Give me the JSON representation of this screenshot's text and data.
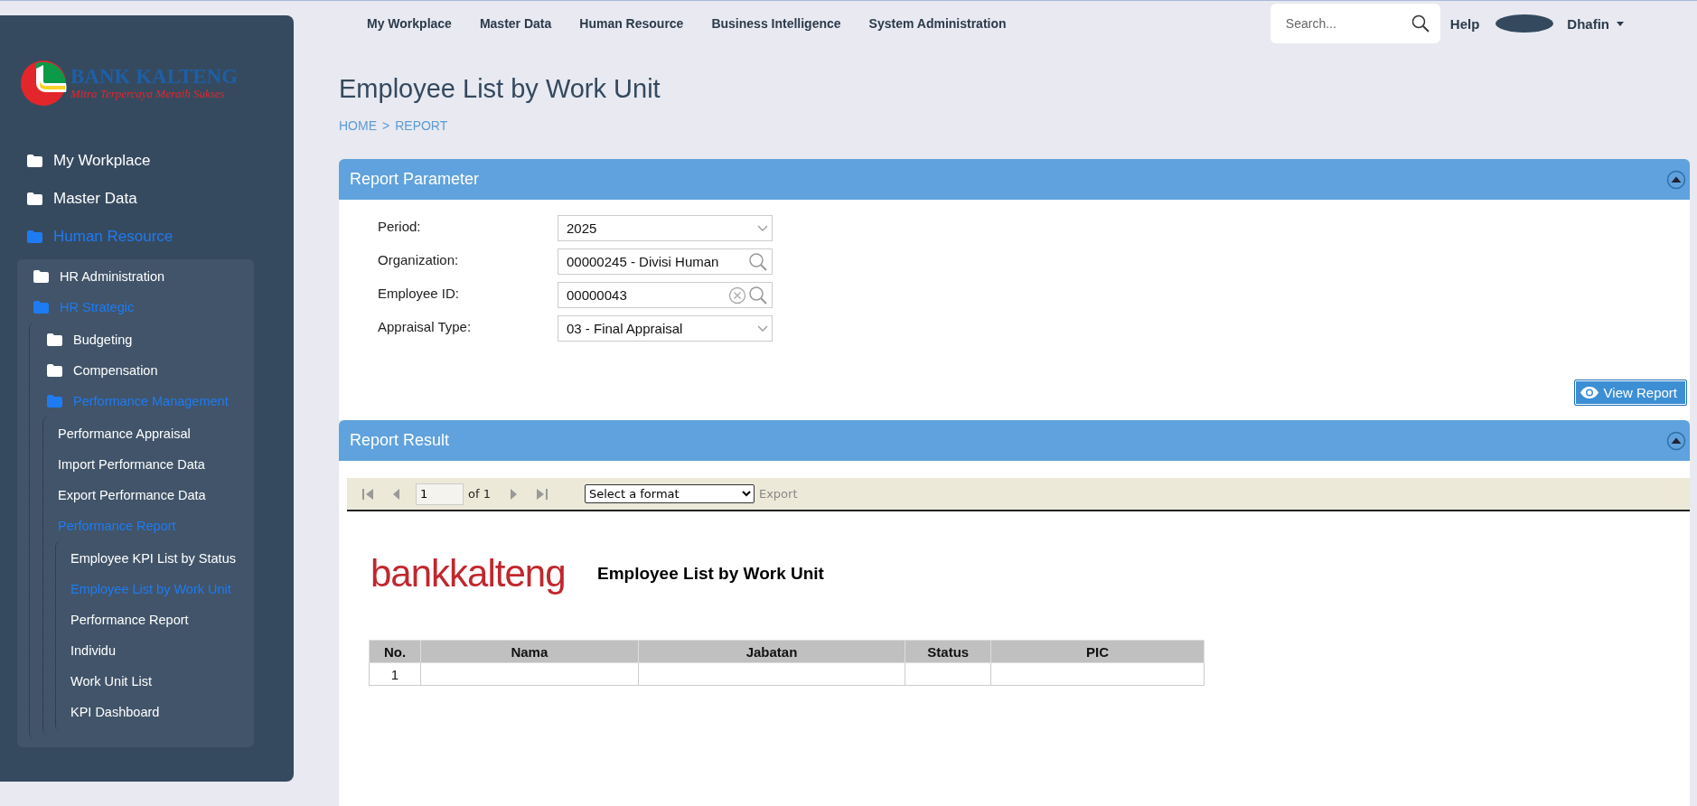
{
  "sidebar": {
    "logo": {
      "name": "BANK KALTENG",
      "tagline": "Mitra Terpercaya Meraih Sukses"
    },
    "items": [
      {
        "label": "My Workplace",
        "kind": "folder",
        "selected": false
      },
      {
        "label": "Master Data",
        "kind": "folder",
        "selected": false
      },
      {
        "label": "Human Resource",
        "kind": "folder",
        "selected": true,
        "children": [
          {
            "label": "HR Administration",
            "kind": "folder",
            "selected": false
          },
          {
            "label": "HR Strategic",
            "kind": "folder",
            "selected": true,
            "children": [
              {
                "label": "Budgeting",
                "kind": "folder",
                "selected": false
              },
              {
                "label": "Compensation",
                "kind": "folder",
                "selected": false
              },
              {
                "label": "Performance Management",
                "kind": "folder",
                "selected": true,
                "children": [
                  {
                    "label": "Performance Appraisal",
                    "kind": "page",
                    "selected": false
                  },
                  {
                    "label": "Import Performance Data",
                    "kind": "page",
                    "selected": false
                  },
                  {
                    "label": "Export Performance Data",
                    "kind": "page",
                    "selected": false
                  },
                  {
                    "label": "Performance Report",
                    "kind": "page",
                    "selected": true,
                    "children": [
                      {
                        "label": "Employee KPI List by Status",
                        "kind": "page",
                        "selected": false
                      },
                      {
                        "label": "Employee List by Work Unit",
                        "kind": "page",
                        "selected": true
                      },
                      {
                        "label": "Performance Report",
                        "kind": "page",
                        "selected": false
                      },
                      {
                        "label": "Individu",
                        "kind": "page",
                        "selected": false
                      },
                      {
                        "label": "Work Unit List",
                        "kind": "page",
                        "selected": false
                      },
                      {
                        "label": "KPI Dashboard",
                        "kind": "page",
                        "selected": false
                      }
                    ]
                  }
                ]
              }
            ]
          }
        ]
      }
    ]
  },
  "top_nav": {
    "items": [
      "My Workplace",
      "Master Data",
      "Human Resource",
      "Business Intelligence",
      "System Administration"
    ],
    "search": {
      "placeholder": "Search..."
    },
    "help": "Help",
    "user": "Dhafin"
  },
  "page": {
    "title": "Employee List by Work Unit",
    "breadcrumb": [
      "HOME",
      "REPORT"
    ],
    "breadcrumb_separator": ">"
  },
  "report_parameter": {
    "title": "Report Parameter",
    "fields": [
      {
        "label": "Period:",
        "kind": "select",
        "value": "2025",
        "clear_button": false
      },
      {
        "label": "Organization:",
        "kind": "lookup",
        "value": "00000245 - Divisi Human",
        "clear_button": false
      },
      {
        "label": "Employee ID:",
        "kind": "lookup",
        "value": "00000043",
        "clear_button": true
      },
      {
        "label": "Appraisal Type:",
        "kind": "select",
        "value": "03 - Final Appraisal",
        "clear_button": false
      }
    ],
    "button": "View Report"
  },
  "report_result": {
    "title": "Report Result",
    "toolbar": {
      "page": "1",
      "of": "of 1",
      "format": "Select a format",
      "export": "Export"
    },
    "report": {
      "logo": {
        "left": "bank",
        "right": "kalteng"
      },
      "title": "Employee List by Work Unit",
      "table": {
        "columns": [
          "No.",
          "Nama",
          "Jabatan",
          "Status",
          "PIC"
        ],
        "rows": [
          {
            "no": "1"
          }
        ]
      }
    }
  }
}
